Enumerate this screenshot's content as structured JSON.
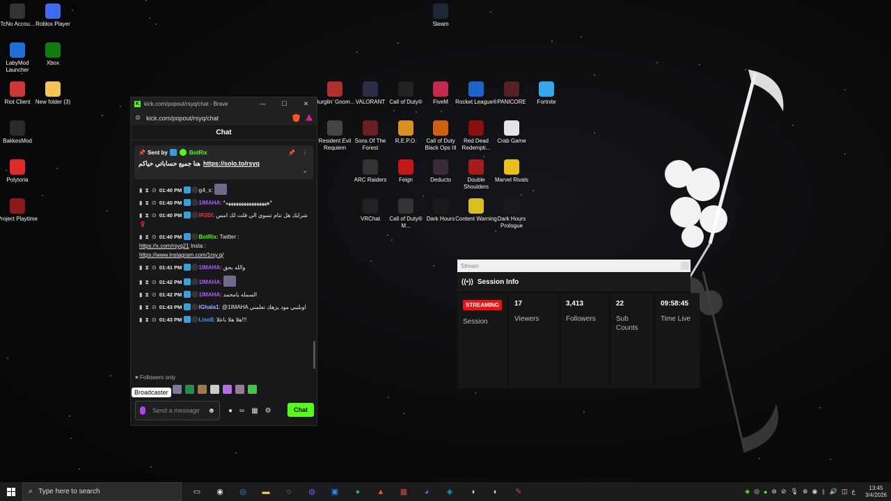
{
  "desktop": {
    "icons_left": [
      {
        "label": "TcNo Accou...",
        "icon": "tcno-icon",
        "color": "#333"
      },
      {
        "label": "Roblox Player",
        "icon": "roblox-icon",
        "color": "#3c6cf0"
      },
      {
        "label": "LabyMod Launcher",
        "icon": "labymod-icon",
        "color": "#1f6fd8"
      },
      {
        "label": "Xbox",
        "icon": "xbox-icon",
        "color": "#107c10"
      },
      {
        "label": "Riot Client",
        "icon": "riot-icon",
        "color": "#d13639"
      },
      {
        "label": "New folder (3)",
        "icon": "folder-icon",
        "color": "#f1c453"
      },
      {
        "label": "BakkesMod",
        "icon": "bakkesmod-icon",
        "color": "#2a2a2a"
      },
      {
        "label": "Polytoria",
        "icon": "polytoria-icon",
        "color": "#e02a2a"
      },
      {
        "label": "Project Playtime",
        "icon": "project-playtime-icon",
        "color": "#8a1a1a"
      }
    ],
    "icons_grid": [
      {
        "label": "Steam",
        "icon": "steam-icon",
        "color": "#1b2838"
      },
      {
        "label": "Burglin' Gnom...",
        "icon": "burglin-gnomes-icon",
        "color": "#b03030"
      },
      {
        "label": "VALORANT",
        "icon": "valorant-icon",
        "color": "#2a2f45"
      },
      {
        "label": "Call of Duty®",
        "icon": "cod-icon",
        "color": "#222"
      },
      {
        "label": "FiveM",
        "icon": "fivem-icon",
        "color": "#c42a4a"
      },
      {
        "label": "Rocket League®",
        "icon": "rocket-league-icon",
        "color": "#1c64c8"
      },
      {
        "label": "PANICORE",
        "icon": "panicore-icon",
        "color": "#552222"
      },
      {
        "label": "Fortnite",
        "icon": "fortnite-icon",
        "color": "#36a7e8"
      },
      {
        "label": "Resident Evil Requiem",
        "icon": "re-requiem-icon",
        "color": "#444"
      },
      {
        "label": "Sons Of The Forest",
        "icon": "sons-forest-icon",
        "color": "#6a1e1e"
      },
      {
        "label": "R.E.P.O.",
        "icon": "repo-icon",
        "color": "#d89020"
      },
      {
        "label": "Call of Duty Black Ops III",
        "icon": "bo3-icon",
        "color": "#d06010"
      },
      {
        "label": "Red Dead Redempti...",
        "icon": "rdr-icon",
        "color": "#8a1010"
      },
      {
        "label": "Crab Game",
        "icon": "crab-game-icon",
        "color": "#e4e4e4"
      },
      {
        "label": "ARC Raiders",
        "icon": "arc-raiders-icon",
        "color": "#333"
      },
      {
        "label": "Feign",
        "icon": "feign-icon",
        "color": "#c01818"
      },
      {
        "label": "Deducto",
        "icon": "deducto-icon",
        "color": "#3a2a3a"
      },
      {
        "label": "Double Shoulders",
        "icon": "double-shoulders-icon",
        "color": "#aa1a1a"
      },
      {
        "label": "Marvel Rivals",
        "icon": "marvel-rivals-icon",
        "color": "#e8c020"
      },
      {
        "label": "VRChat",
        "icon": "vrchat-icon",
        "color": "#222"
      },
      {
        "label": "Call of Duty® M...",
        "icon": "cod-mw-icon",
        "color": "#333"
      },
      {
        "label": "Dark Hours",
        "icon": "dark-hours-icon",
        "color": "#1a1a1a"
      },
      {
        "label": "Content Warning",
        "icon": "content-warning-icon",
        "color": "#d8c020"
      },
      {
        "label": "Dark Hours Prologue",
        "icon": "dark-hours-prologue-icon",
        "color": "#1a1a1a"
      }
    ]
  },
  "browser": {
    "title": "kick.com/popout/rsyq/chat - Brave",
    "url": "kick.com/popout/rsyq/chat",
    "chat_header": "Chat",
    "pinned": {
      "sent_by_label": "Sent by",
      "sender": "BotRix",
      "text": "هنا جميع حساباتي حياكم",
      "link": "https://solo.to/rsyq"
    },
    "messages": [
      {
        "time": "01:40 PM",
        "user": "g4_x",
        "user_color": "#bbbbbb",
        "text": "",
        "emote": true
      },
      {
        "time": "01:40 PM",
        "user": "1IMAHA",
        "user_color": "#b05cff",
        "text": "*ههههههههههههههههه*"
      },
      {
        "time": "01:40 PM",
        "user": "lR3Dl",
        "user_color": "#ff3333",
        "text": "شرايك هل تنام تسوي الي قلت لك امس 🌹"
      },
      {
        "time": "01:40 PM",
        "user": "BotRix",
        "user_color": "#53fc18",
        "text": "Twitter : ",
        "link1": "https://x.com/rsyq21",
        "mid": " Insta : ",
        "link2": "https://www.instagram.com/1rsy.q/"
      },
      {
        "time": "01:41 PM",
        "user": "1IMAHA",
        "user_color": "#b05cff",
        "text": "والله بحق"
      },
      {
        "time": "01:42 PM",
        "user": "1IMAHA",
        "user_color": "#b05cff",
        "text": "",
        "emote": true
      },
      {
        "time": "01:42 PM",
        "user": "1IMAHA",
        "user_color": "#b05cff",
        "text": "السمله يامحمد"
      },
      {
        "time": "01:43 PM",
        "user": "lGhala1",
        "user_color": "#9fb4ff",
        "text": "@1IMAHA اوبليبي مود يزهك تعلمني"
      },
      {
        "time": "01:43 PM",
        "user": "Liso8",
        "user_color": "#3a9fff",
        "text": "هلا هلا باعلا!!!"
      }
    ],
    "followers_only": "Followers only",
    "tooltip": "Broadcaster",
    "input_placeholder": "Send a message",
    "chat_button": "Chat"
  },
  "stream": {
    "window_title": "Stream",
    "section_title": "Session Info",
    "status_badge": "STREAMING",
    "status_label": "Session",
    "stats": [
      {
        "value": "17",
        "label": "Viewers"
      },
      {
        "value": "3,413",
        "label": "Followers"
      },
      {
        "value": "22",
        "label": "Sub Counts"
      },
      {
        "value": "09:58:45",
        "label": "Time Live"
      }
    ]
  },
  "taskbar": {
    "search_placeholder": "Type here to search",
    "pinned_apps": [
      "task-view-icon",
      "obs-icon",
      "chrome-icon",
      "file-explorer-icon",
      "steam-app-icon",
      "discord-canary-icon",
      "browser-window-icon",
      "spotify-icon",
      "brave-icon",
      "game-icon",
      "discord-icon",
      "steam-icon",
      "epic-icon",
      "circle-app-icon",
      "capcut-icon"
    ],
    "time": "13:45",
    "date": "3/4/2026",
    "lang": "ع"
  }
}
